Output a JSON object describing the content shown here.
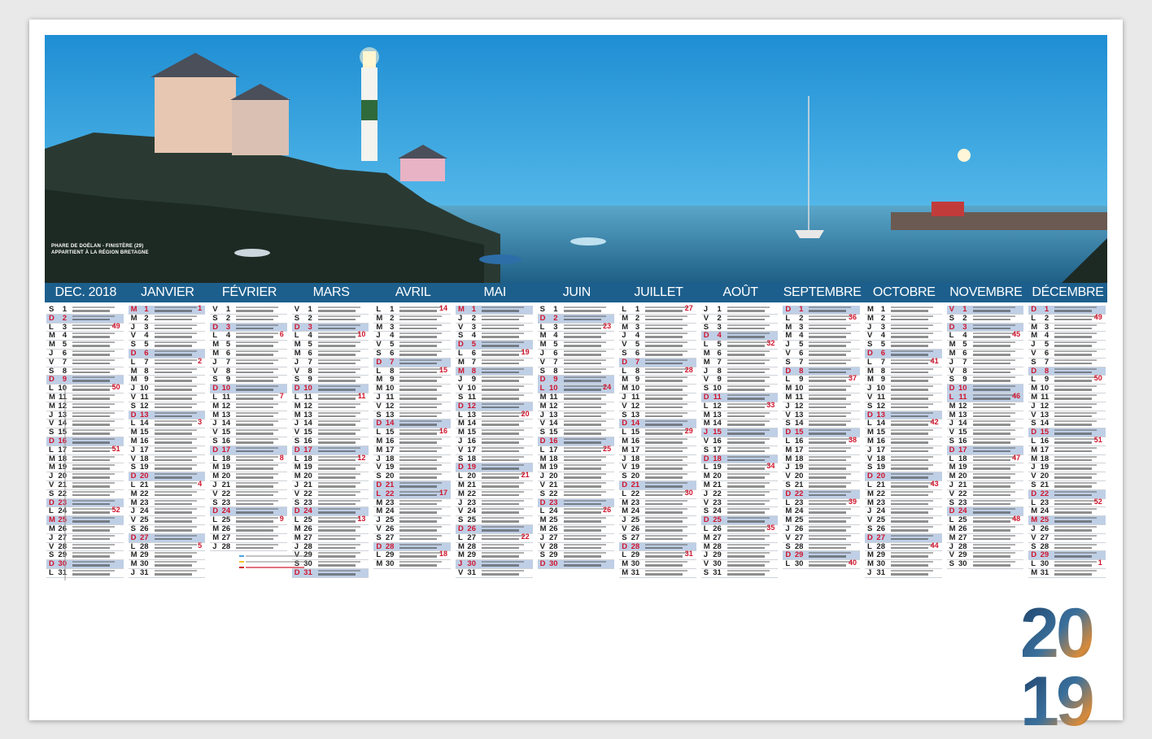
{
  "photo_caption": {
    "line1": "PHARE DE DOËLAN - FINISTÈRE (29)",
    "line2": "APPARTIENT À LA RÉGION BRETAGNE"
  },
  "year": "2019",
  "colors": {
    "month_bar": "#1c5f8d",
    "weekend_row": "#bfcfe6",
    "holiday_red": "#d0142c"
  },
  "months": [
    {
      "name": "DEC. 2018",
      "days": 31,
      "first_weekday": 5
    },
    {
      "name": "JANVIER",
      "days": 31,
      "first_weekday": 1
    },
    {
      "name": "FÉVRIER",
      "days": 28,
      "first_weekday": 4
    },
    {
      "name": "MARS",
      "days": 31,
      "first_weekday": 4
    },
    {
      "name": "AVRIL",
      "days": 30,
      "first_weekday": 0
    },
    {
      "name": "MAI",
      "days": 31,
      "first_weekday": 2
    },
    {
      "name": "JUIN",
      "days": 30,
      "first_weekday": 5
    },
    {
      "name": "JUILLET",
      "days": 31,
      "first_weekday": 0
    },
    {
      "name": "AOÛT",
      "days": 31,
      "first_weekday": 3
    },
    {
      "name": "SEPTEMBRE",
      "days": 30,
      "first_weekday": 6
    },
    {
      "name": "OCTOBRE",
      "days": 31,
      "first_weekday": 1
    },
    {
      "name": "NOVEMBRE",
      "days": 30,
      "first_weekday": 4
    },
    {
      "name": "DÉCEMBRE",
      "days": 31,
      "first_weekday": 6
    }
  ],
  "weekday_letters": [
    "L",
    "M",
    "M",
    "J",
    "V",
    "S",
    "D"
  ],
  "holidays": {
    "DEC. 2018": [
      25
    ],
    "JANVIER": [
      1
    ],
    "FÉVRIER": [],
    "MARS": [],
    "AVRIL": [
      22
    ],
    "MAI": [
      1,
      8,
      30
    ],
    "JUIN": [
      10
    ],
    "JUILLET": [
      14
    ],
    "AOÛT": [
      15
    ],
    "SEPTEMBRE": [],
    "OCTOBRE": [],
    "NOVEMBRE": [
      1,
      11
    ],
    "DÉCEMBRE": [
      25
    ]
  },
  "week_numbers": {
    "DEC. 2018": [
      [
        3,
        49
      ],
      [
        10,
        50
      ],
      [
        17,
        51
      ],
      [
        24,
        52
      ]
    ],
    "JANVIER": [
      [
        1,
        1
      ],
      [
        7,
        2
      ],
      [
        14,
        3
      ],
      [
        21,
        4
      ],
      [
        28,
        5
      ]
    ],
    "FÉVRIER": [
      [
        4,
        6
      ],
      [
        11,
        7
      ],
      [
        18,
        8
      ],
      [
        25,
        9
      ]
    ],
    "MARS": [
      [
        4,
        10
      ],
      [
        11,
        11
      ],
      [
        18,
        12
      ],
      [
        25,
        13
      ]
    ],
    "AVRIL": [
      [
        1,
        14
      ],
      [
        8,
        15
      ],
      [
        15,
        16
      ],
      [
        22,
        17
      ],
      [
        29,
        18
      ]
    ],
    "MAI": [
      [
        6,
        19
      ],
      [
        13,
        20
      ],
      [
        20,
        21
      ],
      [
        27,
        22
      ]
    ],
    "JUIN": [
      [
        3,
        23
      ],
      [
        10,
        24
      ],
      [
        17,
        25
      ],
      [
        24,
        26
      ]
    ],
    "JUILLET": [
      [
        1,
        27
      ],
      [
        8,
        28
      ],
      [
        15,
        29
      ],
      [
        22,
        30
      ],
      [
        29,
        31
      ]
    ],
    "AOÛT": [
      [
        5,
        32
      ],
      [
        12,
        33
      ],
      [
        19,
        34
      ],
      [
        26,
        35
      ]
    ],
    "SEPTEMBRE": [
      [
        2,
        36
      ],
      [
        9,
        37
      ],
      [
        16,
        38
      ],
      [
        23,
        39
      ],
      [
        30,
        40
      ]
    ],
    "OCTOBRE": [
      [
        7,
        41
      ],
      [
        14,
        42
      ],
      [
        21,
        43
      ],
      [
        28,
        44
      ]
    ],
    "NOVEMBRE": [
      [
        4,
        45
      ],
      [
        11,
        46
      ],
      [
        18,
        47
      ],
      [
        25,
        48
      ]
    ],
    "DÉCEMBRE": [
      [
        2,
        49
      ],
      [
        9,
        50
      ],
      [
        16,
        51
      ],
      [
        23,
        52
      ],
      [
        30,
        1
      ]
    ]
  }
}
